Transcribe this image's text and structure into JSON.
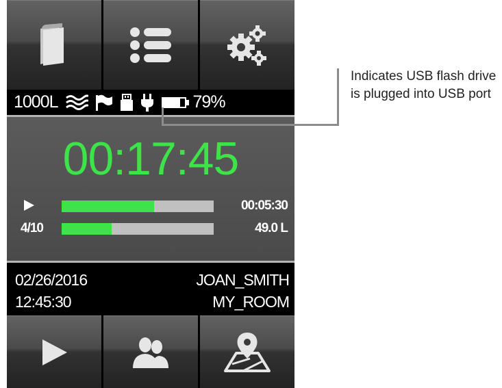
{
  "toolbar": {
    "buttons": [
      {
        "icon": "book-icon"
      },
      {
        "icon": "list-icon"
      },
      {
        "icon": "gears-icon"
      }
    ]
  },
  "status": {
    "volume": "1000L",
    "battery_percent": "79%",
    "battery_level": 0.79,
    "icons": [
      "airflow-icon",
      "flag-icon",
      "usb-icon",
      "power-plug-icon",
      "battery-icon"
    ]
  },
  "main": {
    "timer": "00:17:45",
    "time_progress": {
      "time": "00:05:30",
      "fraction": 0.61
    },
    "sample_progress": {
      "count": "4/10",
      "volume": "49.0 L",
      "fraction": 0.33
    }
  },
  "info": {
    "date": "02/26/2016",
    "time": "12:45:30",
    "user": "JOAN_SMITH",
    "location": "MY_ROOM"
  },
  "bottom": {
    "buttons": [
      {
        "icon": "play-icon"
      },
      {
        "icon": "users-icon"
      },
      {
        "icon": "map-location-icon"
      }
    ]
  },
  "callout": {
    "text": "Indicates USB flash drive is plugged into USB port"
  },
  "colors": {
    "accent_green": "#3ee34a",
    "bar_gray": "#c0c0c0"
  }
}
